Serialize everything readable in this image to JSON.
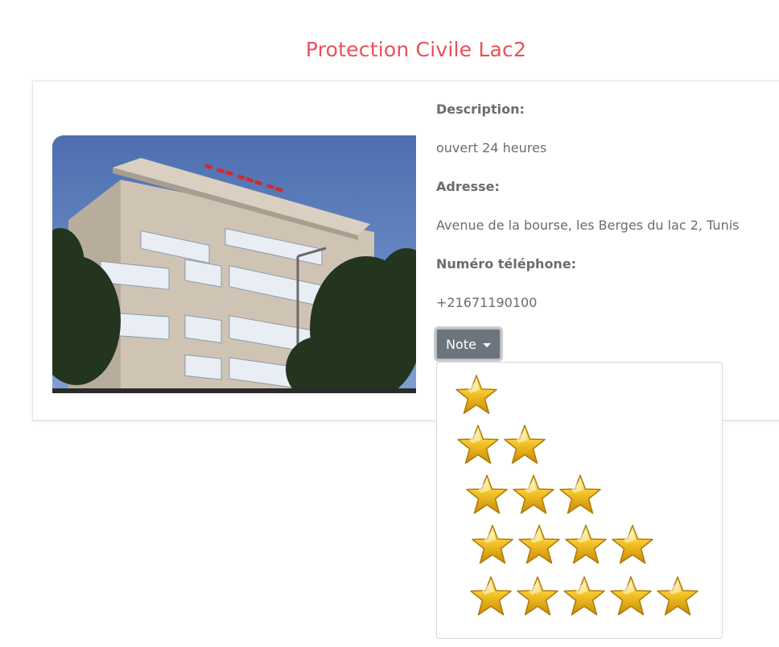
{
  "page": {
    "title": "Protection Civile Lac2"
  },
  "details": {
    "description_label": "Description:",
    "description_value": "ouvert 24 heures",
    "address_label": "Adresse:",
    "address_value": "Avenue de la bourse, les Berges du lac 2, Tunis",
    "phone_label": "Numéro téléphone:",
    "phone_value": "+21671190100"
  },
  "note_dropdown": {
    "button_label": "Note",
    "open": true,
    "options": [
      {
        "stars": 1
      },
      {
        "stars": 2
      },
      {
        "stars": 3
      },
      {
        "stars": 4
      },
      {
        "stars": 5
      }
    ]
  },
  "icons": {
    "dropdown_caret": "caret-down-icon",
    "rating_star": "star-icon"
  },
  "colors": {
    "title": "#e8505b",
    "button": "#6c757d",
    "text": "#6c6c6c",
    "star": "#f2b818"
  }
}
